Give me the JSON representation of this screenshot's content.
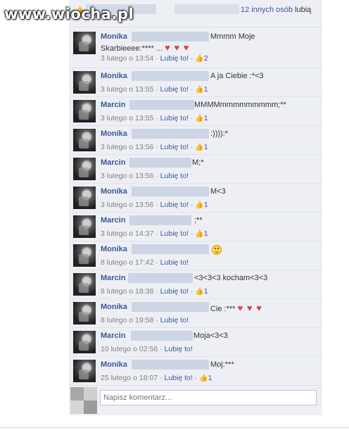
{
  "watermark": "www.wiocha.pl",
  "likes_bar": {
    "others_link": "12 innych osób",
    "suffix": "lubią"
  },
  "composer": {
    "placeholder": "Napisz komentarz..."
  },
  "comments": [
    {
      "name": "Monika",
      "text": "Mmmm Moje",
      "text2": "Skarbieeee:**** ...",
      "hearts": "♥ ♥ ♥",
      "time": "3 lutego o 13:54",
      "like": "Lubię to!",
      "likes": "2"
    },
    {
      "name": "Monika",
      "text": "A ja Ciebie :*<3",
      "time": "3 lutego o 13:55",
      "like": "Lubię to!",
      "likes": "1"
    },
    {
      "name": "Marcin",
      "text": "MMMMmmmmmmmmm;**",
      "time": "3 lutego o 13:55",
      "like": "Lubię to!",
      "likes": "1"
    },
    {
      "name": "Monika",
      "text": ":)))):*",
      "time": "3 lutego o 13:56",
      "like": "Lubię to!",
      "likes": "1"
    },
    {
      "name": "Marcin",
      "text": "M;*",
      "time": "3 lutego o 13:56",
      "like": "Lubię to!",
      "likes": ""
    },
    {
      "name": "Monika",
      "text": "M<3",
      "time": "3 lutego o 13:56",
      "like": "Lubię to!",
      "likes": "1"
    },
    {
      "name": "Marcin",
      "text": ";**",
      "time": "3 lutego o 14:37",
      "like": "Lubię to!",
      "likes": "1"
    },
    {
      "name": "Monika",
      "text": "",
      "time": "8 lutego o 17:42",
      "like": "Lubię to!",
      "likes": ""
    },
    {
      "name": "Marcin",
      "text": "<3<3<3 kocham<3<3",
      "time": "8 lutego o 18:38",
      "like": "Lubię to!",
      "likes": "1"
    },
    {
      "name": "Monika",
      "text": "Cie :***",
      "hearts": "♥ ♥ ♥",
      "time": "8 lutego o 19:58",
      "like": "Lubię to!",
      "likes": ""
    },
    {
      "name": "Marcin",
      "text": "Moja<3<3",
      "time": "10 lutego o 02:56",
      "like": "Lubię to!",
      "likes": ""
    },
    {
      "name": "Monika",
      "text": "Moj:***",
      "time": "25 lutego o 18:07",
      "like": "Lubię to!",
      "likes": "1"
    }
  ],
  "colors": {
    "panel_bg": "#edeff4",
    "link": "#3b5998",
    "meta": "#808080",
    "heart": "#d8434f"
  }
}
